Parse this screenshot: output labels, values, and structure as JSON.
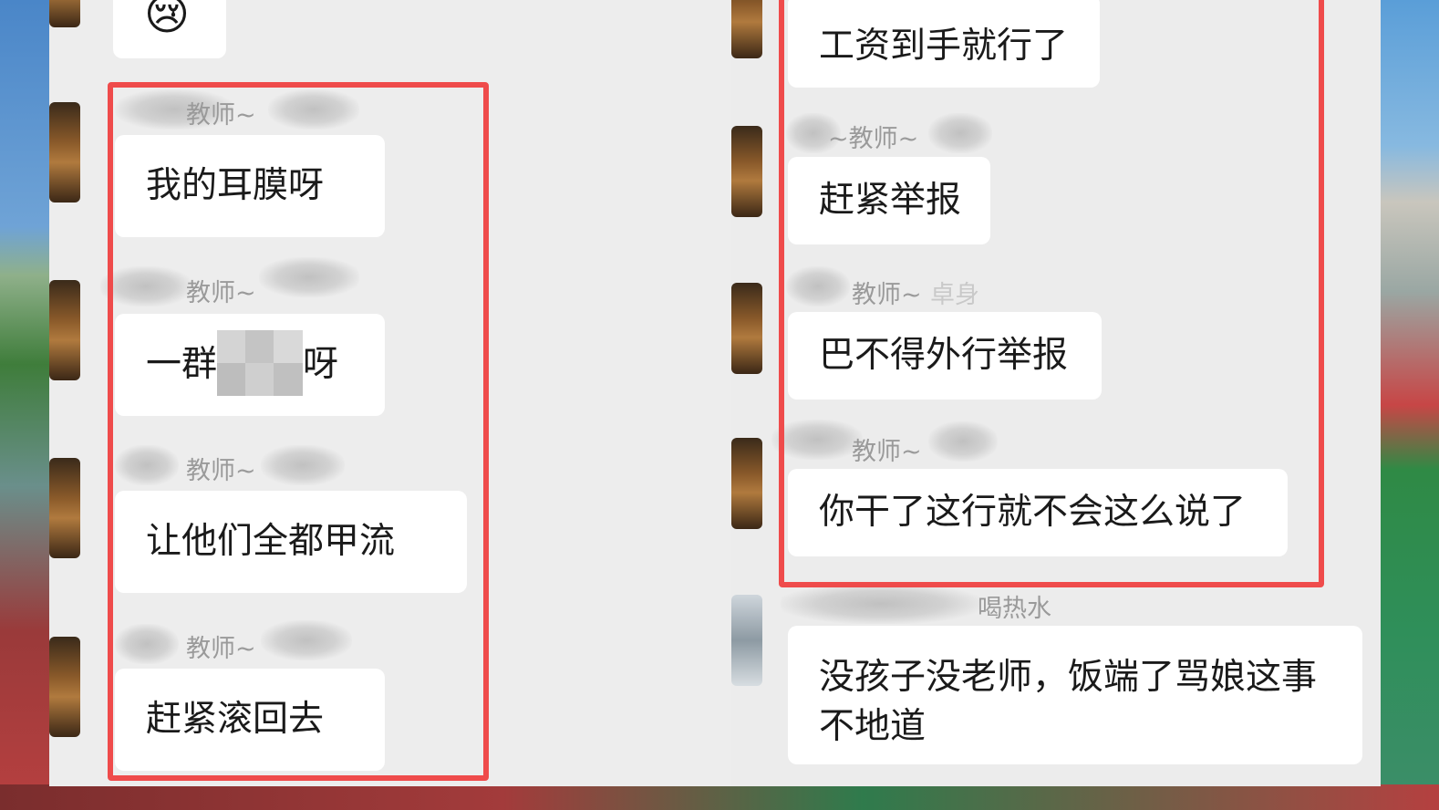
{
  "left_chat": {
    "emoji": "😢",
    "messages": [
      {
        "sender": "教师~",
        "text": "我的耳膜呀"
      },
      {
        "sender": "教师~",
        "text_before": "一群",
        "text_after": "呀"
      },
      {
        "sender": "教师~",
        "text": "让他们全都甲流"
      },
      {
        "sender": "教师~",
        "text": "赶紧滚回去"
      }
    ]
  },
  "right_chat": {
    "messages": [
      {
        "text": "工资到手就行了"
      },
      {
        "sender": "~教师~",
        "text": "赶紧举报"
      },
      {
        "sender": "教师~",
        "sender_suffix": "卓身",
        "text": "巴不得外行举报"
      },
      {
        "sender": "教师~",
        "text": "你干了这行就不会这么说了"
      },
      {
        "sender": "喝热水",
        "text": "没孩子没老师，饭端了骂娘这事不地道"
      }
    ]
  },
  "colors": {
    "highlight_border": "#ef4b4b",
    "chat_background": "#ededed",
    "bubble": "#ffffff"
  }
}
